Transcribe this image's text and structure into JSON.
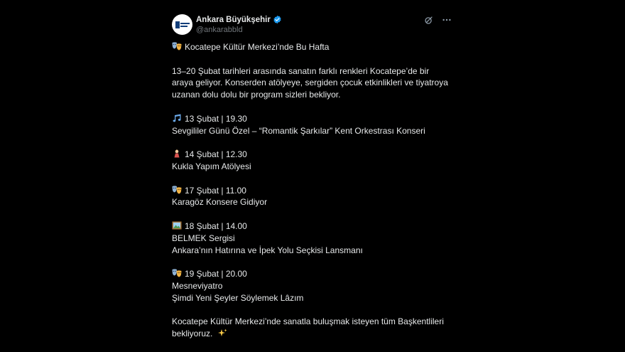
{
  "account": {
    "name": "Ankara Büyükşehir",
    "handle": "@ankarabbld"
  },
  "colors": {
    "background": "#000000",
    "text": "#e7e9ea",
    "muted": "#71767b",
    "verified": "#1d9bf0"
  },
  "icons": {
    "verified": "verified-badge-icon",
    "grok": "grok-icon",
    "more": "more-options-icon"
  },
  "post": {
    "title": "Kocatepe Kültür Merkezi’nde Bu Hafta",
    "intro": [
      "13–20 Şubat tarihleri arasında sanatın farklı renkleri Kocatepe’de bir",
      "araya geliyor. Konserden atölyeye, sergiden çocuk etkinlikleri ve tiyatroya",
      "uzanan dolu dolu bir program sizleri bekliyor."
    ],
    "events": [
      {
        "icon": "musical-notes-icon",
        "date": "13 Şubat | 19.30",
        "lines": [
          "Sevgililer Günü Özel – “Romantik Şarkılar” Kent Orkestrası Konseri"
        ]
      },
      {
        "icon": "puppet-icon",
        "date": "14 Şubat | 12.30",
        "lines": [
          "Kukla Yapım Atölyesi"
        ]
      },
      {
        "icon": "theater-masks-icon",
        "date": "17 Şubat | 11.00",
        "lines": [
          "Karagöz Konsere Gidiyor"
        ]
      },
      {
        "icon": "framed-picture-icon",
        "date": "18 Şubat | 14.00",
        "lines": [
          "BELMEK Sergisi",
          "Ankara’nın Hatırına ve İpek Yolu Seçkisi Lansmanı"
        ]
      },
      {
        "icon": "theater-masks-icon",
        "date": "19 Şubat | 20.00",
        "lines": [
          "Mesneviyatro",
          "Şimdi Yeni Şeyler Söylemek Lâzım"
        ]
      }
    ],
    "closing": [
      "Kocatepe Kültür Merkezi’nde sanatla buluşmak isteyen tüm Başkentlileri",
      "bekliyoruz."
    ]
  }
}
